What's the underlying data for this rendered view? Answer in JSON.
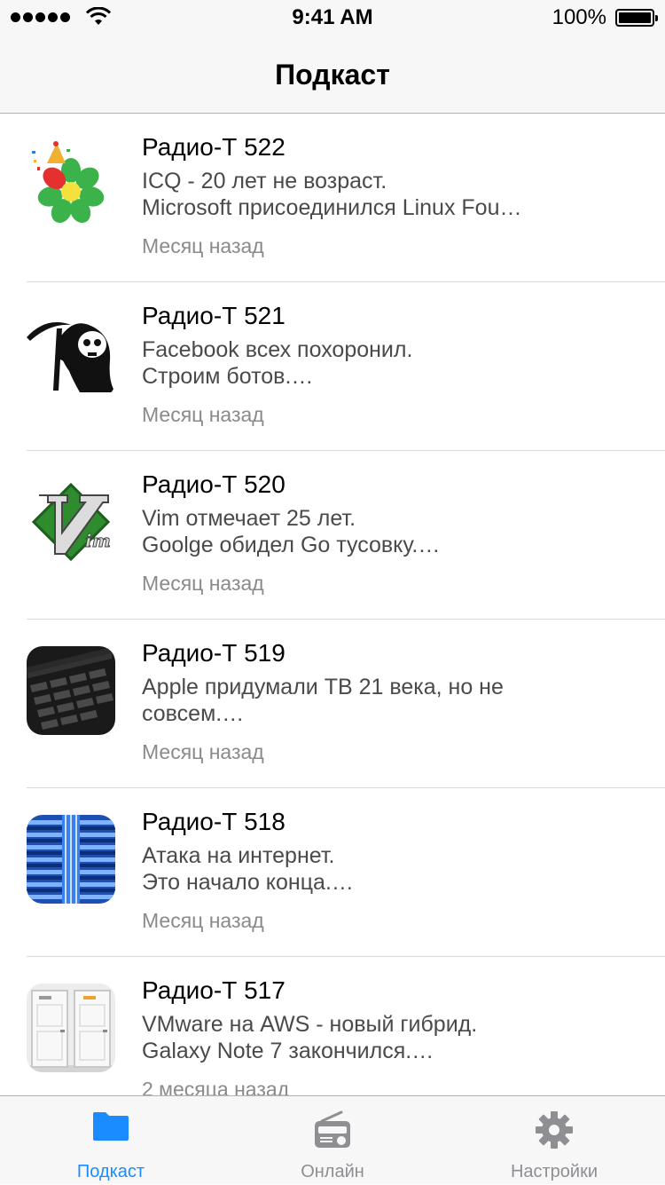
{
  "status_bar": {
    "time": "9:41 AM",
    "battery": "100%",
    "battery_level": 1.0
  },
  "nav": {
    "title": "Подкаст"
  },
  "episodes": [
    {
      "title": "Радио-Т 522",
      "line1": "ICQ - 20 лет не возраст.",
      "line2": "Microsoft присоединился Linux Fou…",
      "date": "Месяц назад",
      "thumb": "icq-flower"
    },
    {
      "title": "Радио-Т 521",
      "line1": "Facebook всех похоронил.",
      "line2": "Строим ботов.…",
      "date": "Месяц назад",
      "thumb": "grim-reaper"
    },
    {
      "title": "Радио-Т 520",
      "line1": "Vim отмечает 25 лет.",
      "line2": "Goolge обидел Go тусовку.…",
      "date": "Месяц назад",
      "thumb": "vim-logo"
    },
    {
      "title": "Радио-Т 519",
      "line1": "Apple придумали TB 21 века, но не",
      "line2": "совсем.…",
      "date": "Месяц назад",
      "thumb": "keyboard-touchbar"
    },
    {
      "title": "Радио-Т 518",
      "line1": "Атака на интернет.",
      "line2": "Это начало конца.…",
      "date": "Месяц назад",
      "thumb": "network-cables"
    },
    {
      "title": "Радио-Т 517",
      "line1": "VMware на AWS - новый гибрид.",
      "line2": "Galaxy Note 7 закончился.…",
      "date": "2 месяца назад",
      "thumb": "two-doors"
    }
  ],
  "tabs": [
    {
      "label": "Подкаст",
      "icon": "folder-icon",
      "active": true
    },
    {
      "label": "Онлайн",
      "icon": "radio-icon",
      "active": false
    },
    {
      "label": "Настройки",
      "icon": "gear-icon",
      "active": false
    }
  ],
  "colors": {
    "accent": "#1a8cff",
    "inactive": "#8e8e93",
    "secondary_text": "#4a4a4a",
    "date_text": "#8a8a8a"
  }
}
